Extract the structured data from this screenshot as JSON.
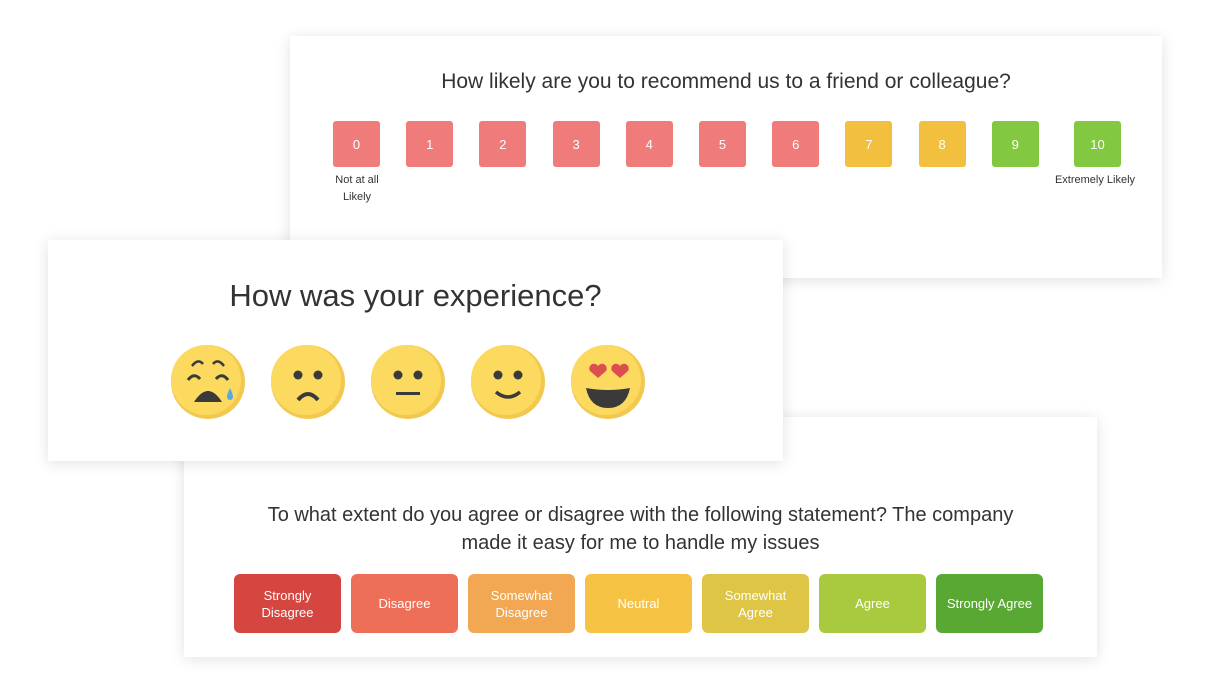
{
  "nps": {
    "question": "How likely are you to recommend us to a friend or colleague?",
    "options": [
      "0",
      "1",
      "2",
      "3",
      "4",
      "5",
      "6",
      "7",
      "8",
      "9",
      "10"
    ],
    "colors": {
      "detractor": "#f07b7b",
      "passive": "#f2bf3f",
      "promoter": "#82c841"
    },
    "low_label": "Not at all Likely",
    "high_label": "Extremely Likely"
  },
  "experience": {
    "question": "How was your experience?",
    "options": [
      "crying-face-icon",
      "frowning-face-icon",
      "neutral-face-icon",
      "smiling-face-icon",
      "heart-eyes-face-icon"
    ]
  },
  "agreement": {
    "question": "To what extent do you agree or disagree with the following statement? The company made it easy for me to handle my issues",
    "options": [
      {
        "label": "Strongly Disagree",
        "color": "#d4463f"
      },
      {
        "label": "Disagree",
        "color": "#ee6f57"
      },
      {
        "label": "Somewhat Disagree",
        "color": "#f2a852"
      },
      {
        "label": "Neutral",
        "color": "#f6c244"
      },
      {
        "label": "Somewhat Agree",
        "color": "#dfc545"
      },
      {
        "label": "Agree",
        "color": "#a9c93f"
      },
      {
        "label": "Strongly Agree",
        "color": "#5aa834"
      }
    ]
  }
}
